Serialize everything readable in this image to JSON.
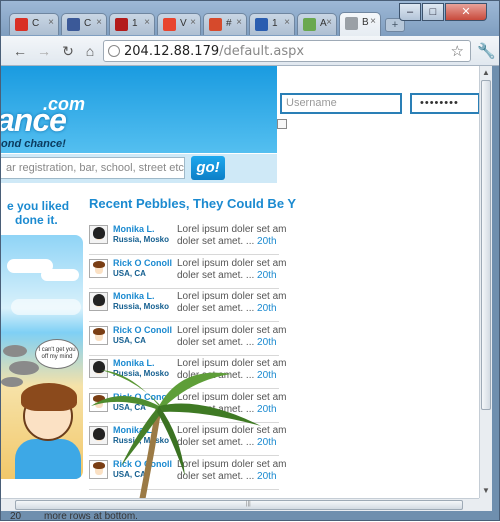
{
  "browser": {
    "tabs": [
      {
        "label": "C",
        "favicon_color": "#d93025"
      },
      {
        "label": "C",
        "favicon_color": "#3b5998"
      },
      {
        "label": "1",
        "favicon_color": "#b31b1b"
      },
      {
        "label": "V",
        "favicon_color": "#e8442e"
      },
      {
        "label": "#",
        "favicon_color": "#d64a2c"
      },
      {
        "label": "1",
        "favicon_color": "#2a5db0"
      },
      {
        "label": "A",
        "favicon_color": "#6aa84f"
      },
      {
        "label": "B",
        "favicon_color": "#9aa0a6"
      }
    ],
    "active_tab_index": 7,
    "url_host": "204.12.88.179",
    "url_path": "/default.aspx",
    "window_buttons": {
      "minimize": "–",
      "maximize": "□",
      "close": "✕"
    }
  },
  "page": {
    "logo": {
      "com": ".com",
      "main": "ance",
      "tagline": "ond chance!"
    },
    "search": {
      "placeholder": "ar registration, bar, school, street etc",
      "go_label": "go!"
    },
    "login": {
      "username_placeholder": "Username",
      "password_value": "••••••••"
    },
    "promo": {
      "line1": "e you liked",
      "line2": "done it."
    },
    "illustration_bubble": "I can't get you off my mind",
    "feed_title": "Recent Pebbles, They Could Be Y",
    "feed": [
      {
        "name": "Monika L.",
        "location": "Russia, Mosko",
        "text1": "Lorel ipsum doler set am",
        "text2": "doler set amet. ...",
        "date": "20th",
        "avatar": "girl"
      },
      {
        "name": "Rick O Conoll",
        "location": "USA, CA",
        "text1": "Lorel ipsum doler set am",
        "text2": "doler set amet. ...",
        "date": "20th",
        "avatar": "kid"
      },
      {
        "name": "Monika L.",
        "location": "Russia, Mosko",
        "text1": "Lorel ipsum doler set am",
        "text2": "doler set amet. ...",
        "date": "20th",
        "avatar": "girl"
      },
      {
        "name": "Rick O Conoll",
        "location": "USA, CA",
        "text1": "Lorel ipsum doler set am",
        "text2": "doler set amet. ...",
        "date": "20th",
        "avatar": "kid"
      },
      {
        "name": "Monika L.",
        "location": "Russia, Mosko",
        "text1": "Lorel ipsum doler set am",
        "text2": "doler set amet. ...",
        "date": "20th",
        "avatar": "girl"
      },
      {
        "name": "Rick O Conoll",
        "location": "USA, CA",
        "text1": "Lorel ipsum doler set am",
        "text2": "doler set amet. ...",
        "date": "20th",
        "avatar": "kid"
      },
      {
        "name": "Monika L.",
        "location": "Russia, Mosko",
        "text1": "Lorel ipsum doler set am",
        "text2": "doler set amet. ...",
        "date": "20th",
        "avatar": "girl"
      },
      {
        "name": "Rick O Conoll",
        "location": "USA, CA",
        "text1": "Lorel ipsum doler set am",
        "text2": "doler set amet. ...",
        "date": "20th",
        "avatar": "kid"
      }
    ]
  },
  "below_window": {
    "number": "20",
    "text": "more rows at bottom."
  }
}
